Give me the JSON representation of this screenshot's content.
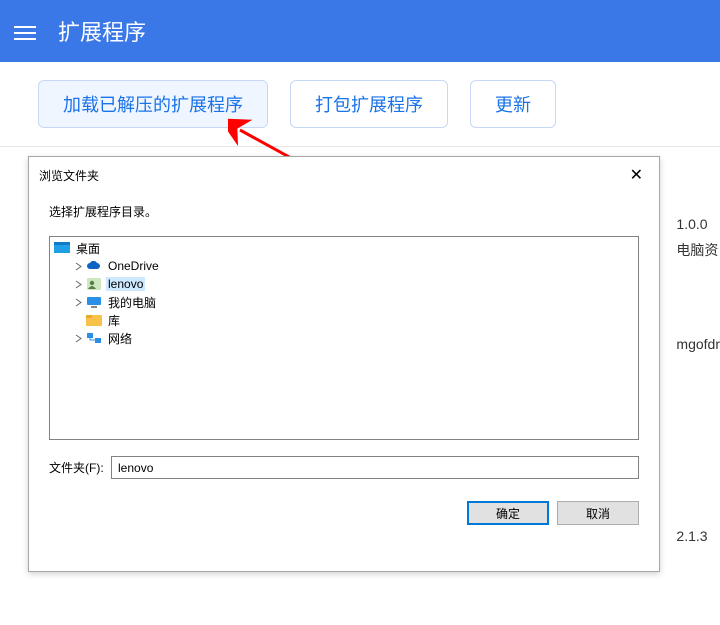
{
  "header": {
    "title": "扩展程序"
  },
  "toolbar": {
    "load_unpacked": "加载已解压的扩展程序",
    "pack": "打包扩展程序",
    "update": "更新"
  },
  "dialog": {
    "title": "浏览文件夹",
    "instruction": "选择扩展程序目录。",
    "folder_label": "文件夹(F):",
    "folder_value": "lenovo",
    "ok_label": "确定",
    "cancel_label": "取消"
  },
  "tree": {
    "root": "桌面",
    "children": [
      {
        "label": "OneDrive",
        "icon": "cloud",
        "expandable": true
      },
      {
        "label": "lenovo",
        "icon": "user",
        "expandable": true,
        "selected": true
      },
      {
        "label": "我的电脑",
        "icon": "pc",
        "expandable": true
      },
      {
        "label": "库",
        "icon": "lib",
        "expandable": false
      },
      {
        "label": "网络",
        "icon": "net",
        "expandable": true
      }
    ]
  },
  "background_fragments": {
    "f1": "1.0.0",
    "f2": "电脑资",
    "f3": "mgofdr",
    "f4": "2.1.3"
  },
  "colors": {
    "primary": "#3b78e7",
    "link": "#1a73e8",
    "selection": "#cde8ff",
    "arrow": "#ff0000"
  }
}
